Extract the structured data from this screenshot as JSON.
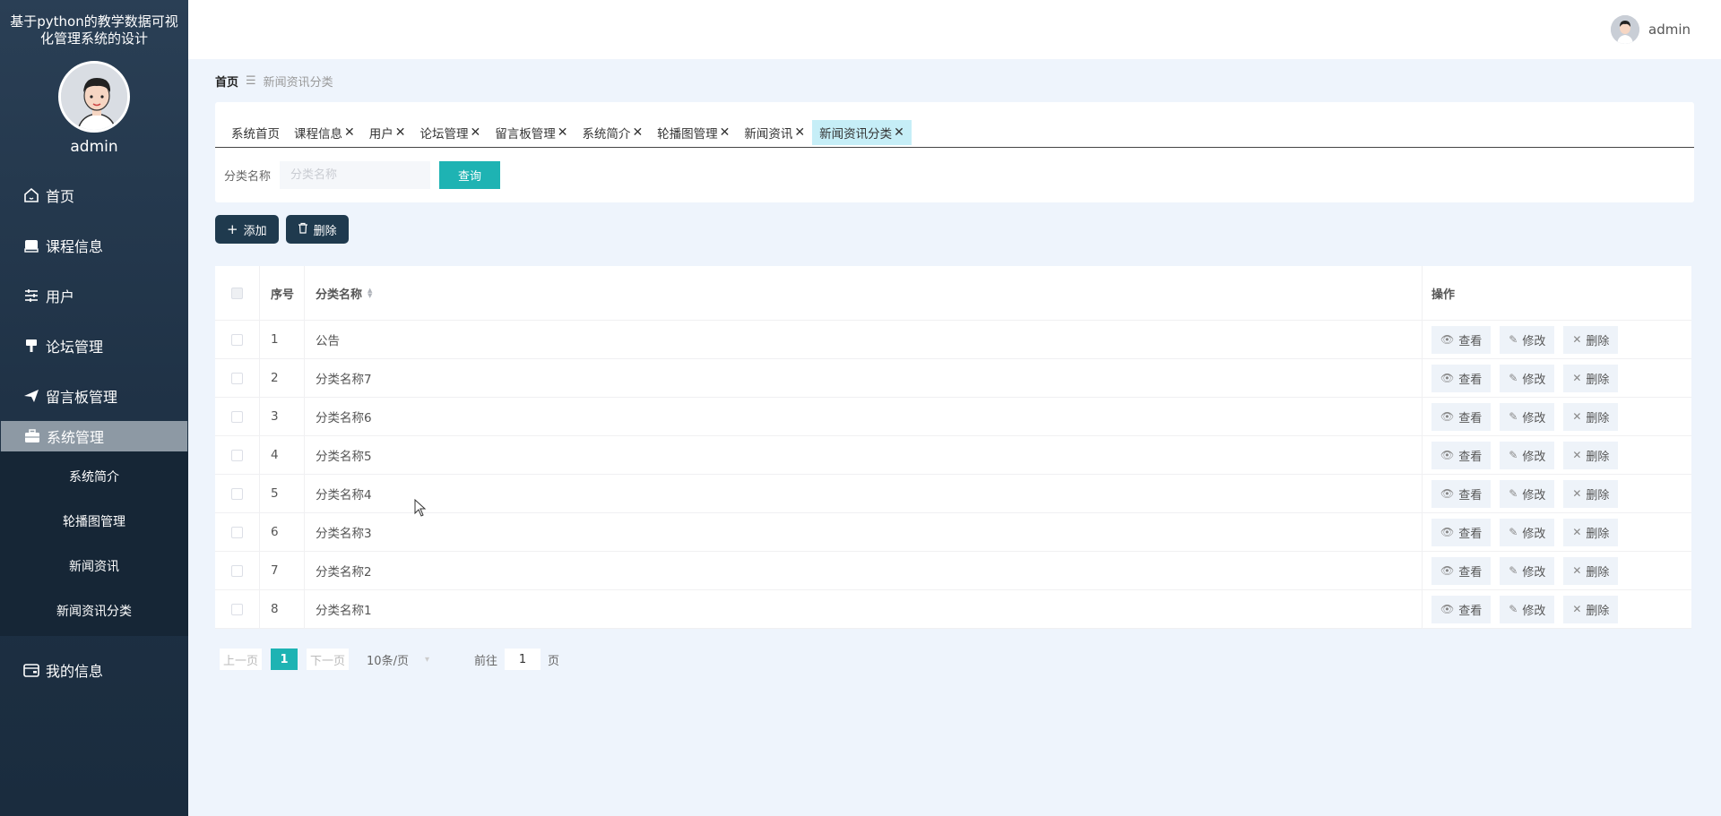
{
  "app": {
    "title": "基于python的教学数据可视化管理系统的设计"
  },
  "sidebar": {
    "username": "admin",
    "menu": [
      {
        "label": "首页",
        "icon": "home-icon"
      },
      {
        "label": "课程信息",
        "icon": "book-icon"
      },
      {
        "label": "用户",
        "icon": "sliders-icon"
      },
      {
        "label": "论坛管理",
        "icon": "paint-roller-icon"
      },
      {
        "label": "留言板管理",
        "icon": "paper-plane-icon"
      },
      {
        "label": "系统管理",
        "icon": "briefcase-icon"
      }
    ],
    "submenu": [
      "系统简介",
      "轮播图管理",
      "新闻资讯",
      "新闻资讯分类"
    ],
    "my_info": {
      "label": "我的信息",
      "icon": "wallet-icon"
    }
  },
  "header": {
    "username": "admin"
  },
  "breadcrumb": {
    "home": "首页",
    "current": "新闻资讯分类"
  },
  "tabs": [
    {
      "label": "系统首页",
      "closable": false
    },
    {
      "label": "课程信息",
      "closable": true
    },
    {
      "label": "用户",
      "closable": true
    },
    {
      "label": "论坛管理",
      "closable": true
    },
    {
      "label": "留言板管理",
      "closable": true
    },
    {
      "label": "系统简介",
      "closable": true
    },
    {
      "label": "轮播图管理",
      "closable": true
    },
    {
      "label": "新闻资讯",
      "closable": true
    },
    {
      "label": "新闻资讯分类",
      "closable": true,
      "active": true
    }
  ],
  "search": {
    "label": "分类名称",
    "placeholder": "分类名称",
    "value": "",
    "button": "查询"
  },
  "actions": {
    "add": "添加",
    "delete": "删除"
  },
  "table": {
    "columns": {
      "index": "序号",
      "name": "分类名称",
      "ops": "操作"
    },
    "rows": [
      {
        "index": "1",
        "name": "公告"
      },
      {
        "index": "2",
        "name": "分类名称7"
      },
      {
        "index": "3",
        "name": "分类名称6"
      },
      {
        "index": "4",
        "name": "分类名称5"
      },
      {
        "index": "5",
        "name": "分类名称4"
      },
      {
        "index": "6",
        "name": "分类名称3"
      },
      {
        "index": "7",
        "name": "分类名称2"
      },
      {
        "index": "8",
        "name": "分类名称1"
      }
    ],
    "ops": {
      "view": "查看",
      "edit": "修改",
      "delete": "删除"
    }
  },
  "pagination": {
    "prev": "上一页",
    "current": "1",
    "next": "下一页",
    "page_size": "10条/页",
    "goto_prefix": "前往",
    "goto_value": "1",
    "goto_suffix": "页"
  },
  "colors": {
    "accent": "#1eb3b3",
    "sidebar": "#1f3246",
    "dark_button": "#1f3a4e",
    "active_tab": "#c6eef7"
  }
}
